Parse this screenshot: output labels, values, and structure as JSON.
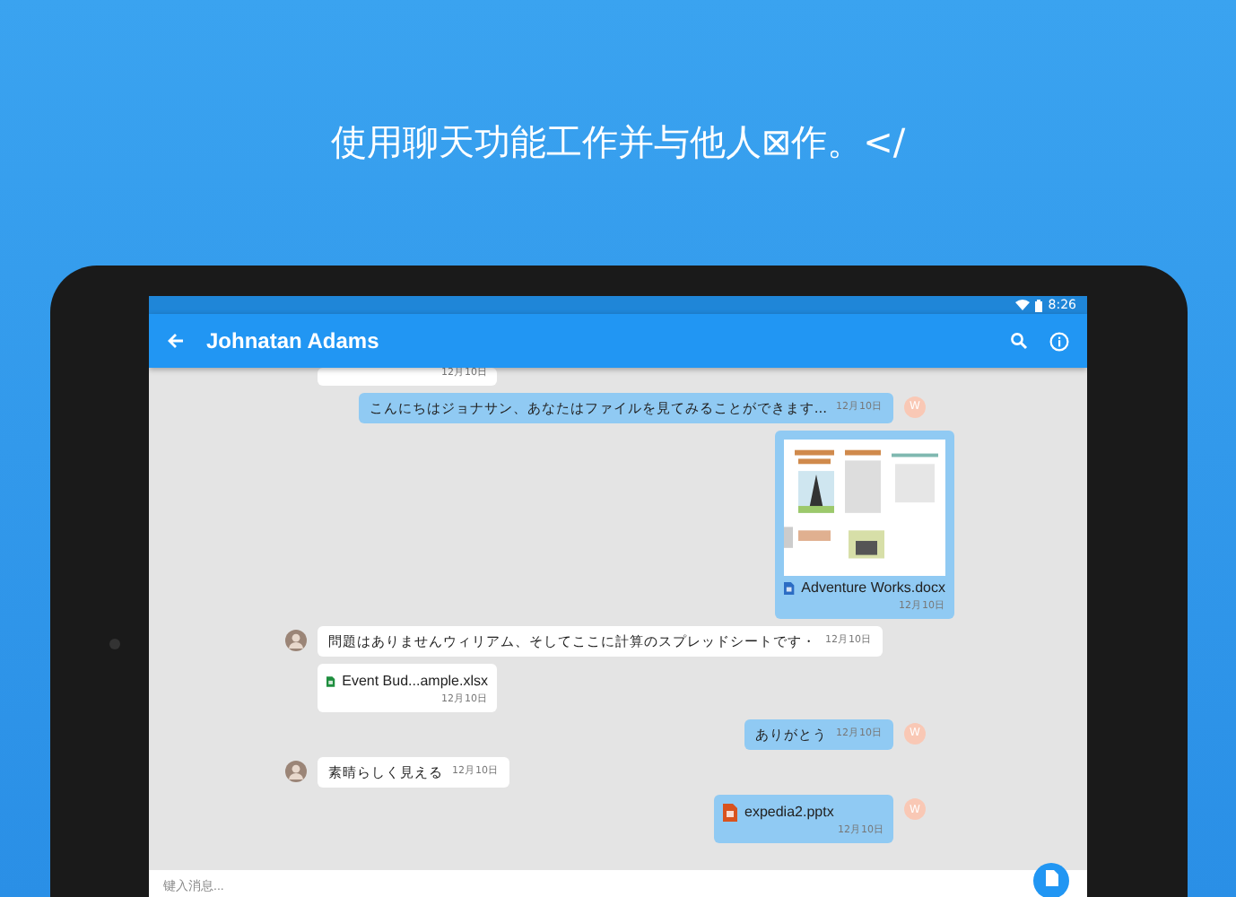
{
  "headline": "使用聊天功能工作并与他人⊠作。</",
  "status_bar": {
    "time": "8:26"
  },
  "app_bar": {
    "title": "Johnatan Adams"
  },
  "messages": [
    {
      "kind": "file_tail",
      "outgoing": false,
      "time": "12月10日"
    },
    {
      "kind": "text",
      "outgoing": true,
      "text": "こんにちはジョナサン、あなたはファイルを見てみることができます...",
      "time": "12月10日",
      "avatar": "W"
    },
    {
      "kind": "word_preview",
      "outgoing": true,
      "file": "Adventure Works.docx",
      "time": "12月10日"
    },
    {
      "kind": "text",
      "outgoing": false,
      "photo": true,
      "text": "問題はありませんウィリアム、そしてここに計算のスプレッドシートです・",
      "time": "12月10日"
    },
    {
      "kind": "sheet_file",
      "outgoing": false,
      "file": "Event Bud...ample.xlsx",
      "time": "12月10日"
    },
    {
      "kind": "text",
      "outgoing": true,
      "text": "ありがとう",
      "time": "12月10日",
      "avatar": "W"
    },
    {
      "kind": "text",
      "outgoing": false,
      "photo": true,
      "text": "素晴らしく見える",
      "time": "12月10日"
    },
    {
      "kind": "slides_file",
      "outgoing": true,
      "file": "expedia2.pptx",
      "time": "12月10日",
      "avatar": "W"
    }
  ],
  "composer": {
    "placeholder": "键入消息..."
  }
}
